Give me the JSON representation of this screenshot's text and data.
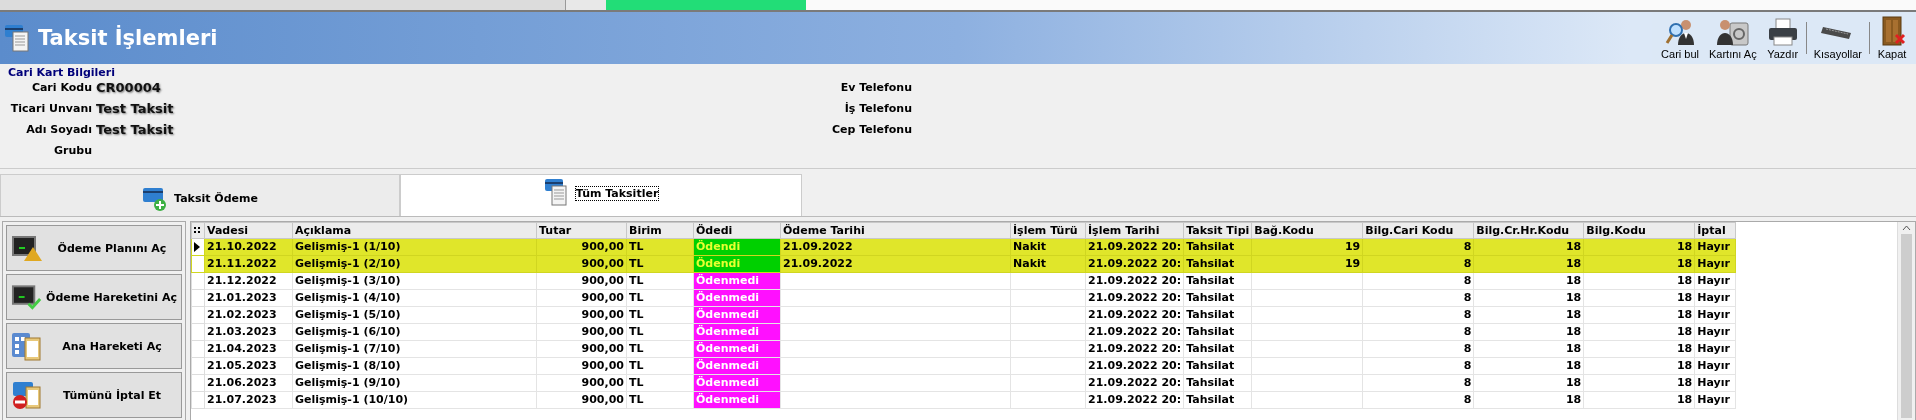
{
  "window": {
    "title": "Taksit İşlemleri"
  },
  "toolbar": [
    {
      "label": "Cari bul",
      "kind": "find"
    },
    {
      "label": "Kartını Aç",
      "kind": "card"
    },
    {
      "label": "Yazdır",
      "kind": "print"
    },
    {
      "label": "Kısayollar",
      "kind": "keyboard"
    },
    {
      "label": "Kapat",
      "kind": "close"
    }
  ],
  "customer_info": {
    "title": "Cari Kart Bilgileri",
    "left_fields": [
      {
        "label": "Cari Kodu",
        "value": "CR00004"
      },
      {
        "label": "Ticari Unvanı",
        "value": "Test Taksit"
      },
      {
        "label": "Adı Soyadı",
        "value": "Test Taksit"
      },
      {
        "label": "Grubu"
      }
    ],
    "right_fields": [
      {
        "label": "Ev Telefonu"
      },
      {
        "label": "İş Telefonu"
      },
      {
        "label": "Cep Telefonu"
      }
    ]
  },
  "tabs": [
    {
      "label": "Taksit Ödeme",
      "selected": false,
      "kind": "pay"
    },
    {
      "label": "Tüm Taksitler",
      "selected": true,
      "kind": "list"
    }
  ],
  "actions": [
    {
      "label": "Ödeme Planını Aç",
      "kind": "plan"
    },
    {
      "label": "Ödeme Hareketini Aç",
      "kind": "movement"
    },
    {
      "label": "Ana Hareketi Aç",
      "kind": "main"
    },
    {
      "label": "Tümünü İptal Et",
      "kind": "cancel"
    }
  ],
  "table": {
    "columns": [
      "Vadesi",
      "Açıklama",
      "Tutar",
      "Birim",
      "Ödedi",
      "Ödeme Tarihi",
      "İşlem Türü",
      "İşlem Tarihi",
      "Taksit Tipi",
      "Bağ.Kodu",
      "Bilg.Cari Kodu",
      "Bilg.Cr.Hr.Kodu",
      "Bilg.Kodu",
      "İptal"
    ],
    "rows": [
      {
        "current": true,
        "paid": true,
        "cells": [
          "21.10.2022",
          "Gelişmiş-1 (1/10)",
          "900,00",
          "TL",
          "Ödendi",
          "21.09.2022",
          "Nakit",
          "21.09.2022 20:",
          "Tahsilat",
          "19",
          "8",
          "18",
          "18",
          "Hayır"
        ]
      },
      {
        "current": false,
        "paid": true,
        "cells": [
          "21.11.2022",
          "Gelişmiş-1 (2/10)",
          "900,00",
          "TL",
          "Ödendi",
          "21.09.2022",
          "Nakit",
          "21.09.2022 20:",
          "Tahsilat",
          "19",
          "8",
          "18",
          "18",
          "Hayır"
        ]
      },
      {
        "current": false,
        "paid": false,
        "cells": [
          "21.12.2022",
          "Gelişmiş-1 (3/10)",
          "900,00",
          "TL",
          "Ödenmedi",
          null,
          null,
          "21.09.2022 20:",
          "Tahsilat",
          null,
          "8",
          "18",
          "18",
          "Hayır"
        ]
      },
      {
        "current": false,
        "paid": false,
        "cells": [
          "21.01.2023",
          "Gelişmiş-1 (4/10)",
          "900,00",
          "TL",
          "Ödenmedi",
          null,
          null,
          "21.09.2022 20:",
          "Tahsilat",
          null,
          "8",
          "18",
          "18",
          "Hayır"
        ]
      },
      {
        "current": false,
        "paid": false,
        "cells": [
          "21.02.2023",
          "Gelişmiş-1 (5/10)",
          "900,00",
          "TL",
          "Ödenmedi",
          null,
          null,
          "21.09.2022 20:",
          "Tahsilat",
          null,
          "8",
          "18",
          "18",
          "Hayır"
        ]
      },
      {
        "current": false,
        "paid": false,
        "cells": [
          "21.03.2023",
          "Gelişmiş-1 (6/10)",
          "900,00",
          "TL",
          "Ödenmedi",
          null,
          null,
          "21.09.2022 20:",
          "Tahsilat",
          null,
          "8",
          "18",
          "18",
          "Hayır"
        ]
      },
      {
        "current": false,
        "paid": false,
        "cells": [
          "21.04.2023",
          "Gelişmiş-1 (7/10)",
          "900,00",
          "TL",
          "Ödenmedi",
          null,
          null,
          "21.09.2022 20:",
          "Tahsilat",
          null,
          "8",
          "18",
          "18",
          "Hayır"
        ]
      },
      {
        "current": false,
        "paid": false,
        "cells": [
          "21.05.2023",
          "Gelişmiş-1 (8/10)",
          "900,00",
          "TL",
          "Ödenmedi",
          null,
          null,
          "21.09.2022 20:",
          "Tahsilat",
          null,
          "8",
          "18",
          "18",
          "Hayır"
        ]
      },
      {
        "current": false,
        "paid": false,
        "cells": [
          "21.06.2023",
          "Gelişmiş-1 (9/10)",
          "900,00",
          "TL",
          "Ödenmedi",
          null,
          null,
          "21.09.2022 20:",
          "Tahsilat",
          null,
          "8",
          "18",
          "18",
          "Hayır"
        ]
      },
      {
        "current": false,
        "paid": false,
        "cells": [
          "21.07.2023",
          "Gelişmiş-1 (10/10)",
          "900,00",
          "TL",
          "Ödenmedi",
          null,
          null,
          "21.09.2022 20:",
          "Tahsilat",
          null,
          "8",
          "18",
          "18",
          "Hayır"
        ]
      }
    ]
  }
}
